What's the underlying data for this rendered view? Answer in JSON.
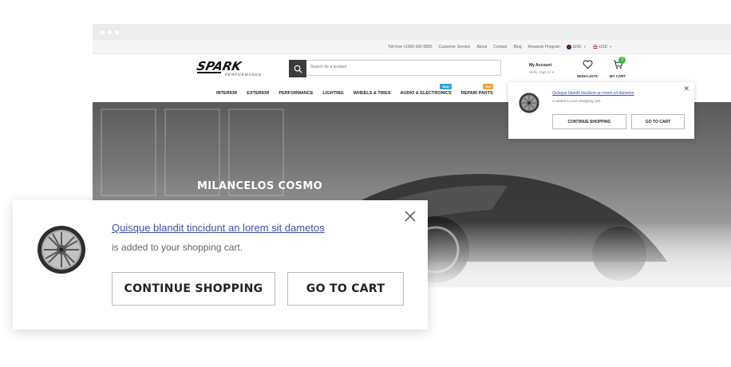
{
  "topbar": {
    "links": [
      "Toll-free +1900 000 6890",
      "Customer Service",
      "About",
      "Contact",
      "Blog",
      "Rewards Program"
    ],
    "language": "ENG",
    "currency": "USD"
  },
  "header": {
    "logo_word": "SPARK",
    "logo_sub": "PERFORMANCE",
    "search_placeholder": "Search for a product",
    "account_title": "My Account",
    "account_sub": "Hello, Sign In",
    "wishlist_label": "WISH LISTS",
    "cart_label": "MY CART",
    "cart_count": "3"
  },
  "nav": {
    "items": [
      "INTERIOR",
      "EXTERIOR",
      "PERFORMANCE",
      "LIGHTING",
      "WHEELS & TIRES",
      "AUDIO & ELECTRONICS",
      "REPAIR PARTS"
    ],
    "tag_new": "New",
    "tag_hot": "Hot"
  },
  "hero": {
    "title": "MILANCELOS COSMO"
  },
  "popup": {
    "product_link": "Quisque blandit tincidunt an lorem sit dametos",
    "message": "is added to your shopping cart.",
    "continue_label": "CONTINUE SHOPPING",
    "cart_label": "GO TO CART"
  },
  "colors": {
    "link": "#3a4fa8",
    "cart_badge": "#3bb34a",
    "tag_new": "#2fa4d9",
    "tag_hot": "#f0a23a"
  },
  "icons": [
    "search-icon",
    "user-icon",
    "heart-icon",
    "cart-icon",
    "close-icon",
    "wheel-icon"
  ]
}
